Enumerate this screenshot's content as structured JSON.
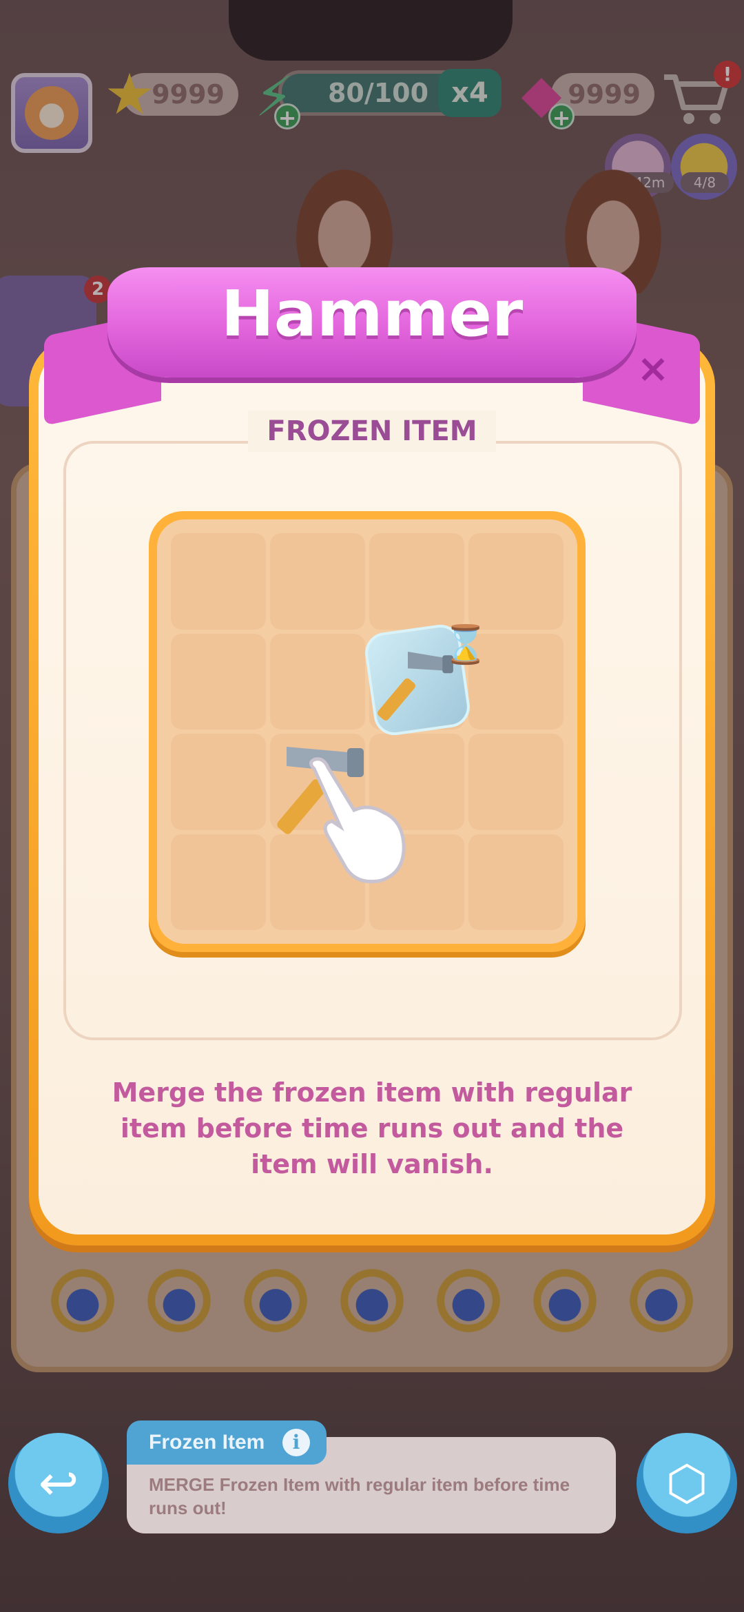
{
  "hud": {
    "stars": "9999",
    "energy": "80/100",
    "multiplier": "x4",
    "gems": "9999",
    "cart_badge": "!",
    "timer_label": "3h 42m",
    "progress_label": "4/8",
    "side_badge": "2"
  },
  "dialog": {
    "title": "Hammer",
    "close": "×",
    "section_title": "FROZEN ITEM",
    "description": "Merge the frozen item with regular item before time runs out and the item will vanish."
  },
  "hint": {
    "title": "Frozen Item",
    "info": "i",
    "text": "MERGE Frozen Item with regular item before time runs out!"
  },
  "icons": {
    "star": "star-icon",
    "energy": "lightning-icon",
    "gem": "gem-icon",
    "cart": "cart-icon",
    "back": "back-arrow-icon",
    "box": "box-icon",
    "hammer": "hammer-icon",
    "hourglass": "hourglass-icon",
    "pointer": "pointing-hand-icon"
  },
  "colors": {
    "ribbon": "#e265dc",
    "frame": "#ffb13a",
    "text_pink": "#c35a9d",
    "section_purple": "#9a4d95"
  }
}
